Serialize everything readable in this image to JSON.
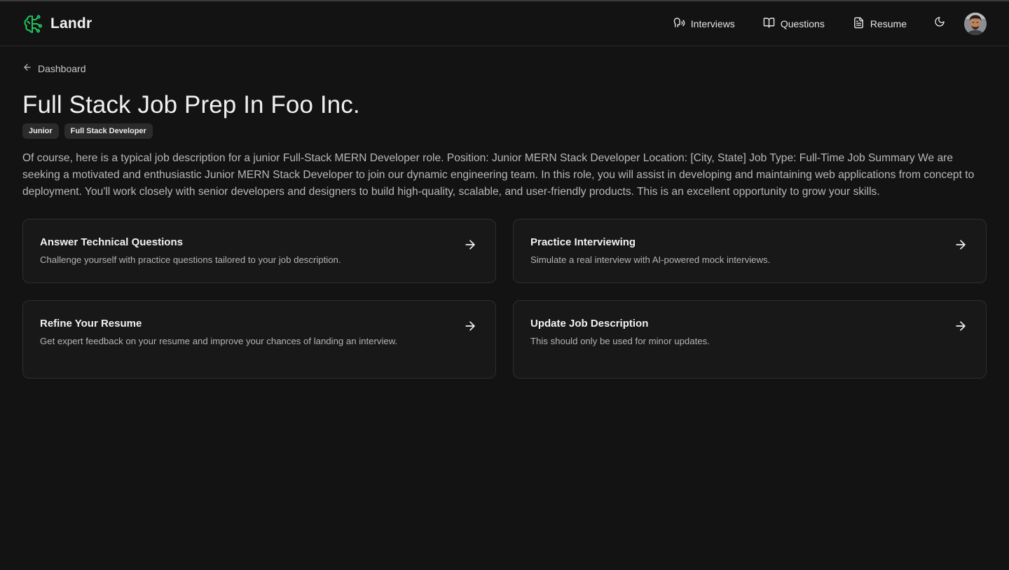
{
  "app": {
    "name": "Landr",
    "logo_icon": "brain-circuit-icon",
    "accent": "#22c55e"
  },
  "nav": {
    "items": [
      {
        "label": "Interviews",
        "icon": "speech-icon"
      },
      {
        "label": "Questions",
        "icon": "book-open-icon"
      },
      {
        "label": "Resume",
        "icon": "file-text-icon"
      }
    ],
    "theme_icon": "moon-icon"
  },
  "breadcrumb": {
    "back_label": "Dashboard"
  },
  "job": {
    "title": "Full Stack Job Prep In Foo Inc.",
    "badges": [
      "Junior",
      "Full Stack Developer"
    ],
    "description": "Of course, here is a typical job description for a junior Full-Stack MERN Developer role. Position: Junior MERN Stack Developer Location: [City, State] Job Type: Full-Time Job Summary We are seeking a motivated and enthusiastic Junior MERN Stack Developer to join our dynamic engineering team. In this role, you will assist in developing and maintaining web applications from concept to deployment. You'll work closely with senior developers and designers to build high-quality, scalable, and user-friendly products. This is an excellent opportunity to grow your skills."
  },
  "cards": [
    {
      "title": "Answer Technical Questions",
      "description": "Challenge yourself with practice questions tailored to your job description."
    },
    {
      "title": "Practice Interviewing",
      "description": "Simulate a real interview with AI-powered mock interviews."
    },
    {
      "title": "Refine Your Resume",
      "description": "Get expert feedback on your resume and improve your chances of landing an interview."
    },
    {
      "title": "Update Job Description",
      "description": "This should only be used for minor updates."
    }
  ]
}
